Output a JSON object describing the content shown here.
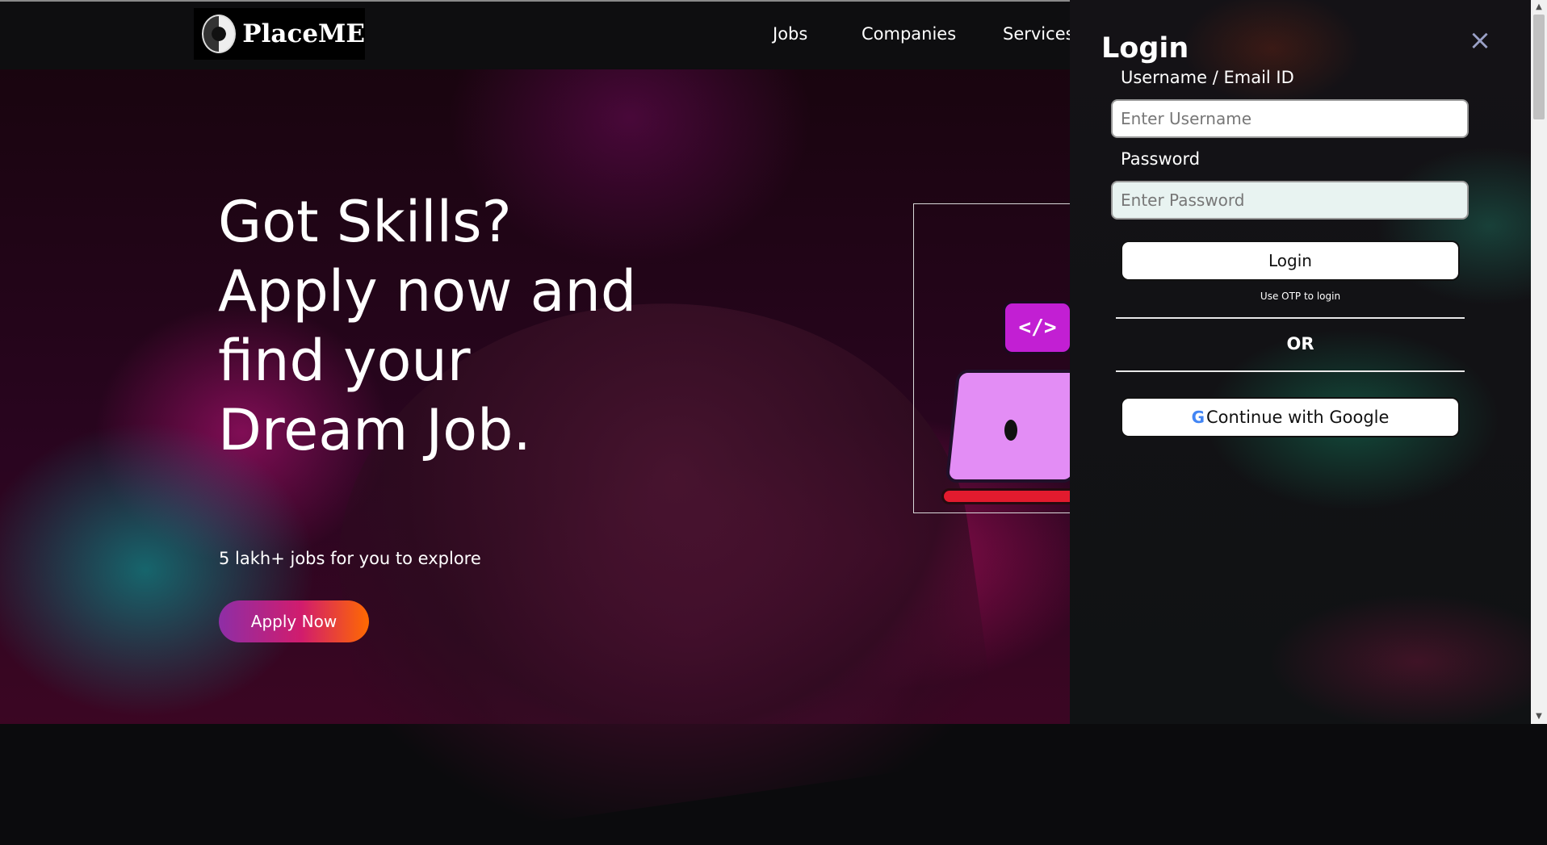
{
  "brand": {
    "name": "PlaceME",
    "logo_icon": "yin-yang-logo-icon"
  },
  "nav": {
    "items": [
      {
        "label": "Jobs"
      },
      {
        "label": "Companies"
      },
      {
        "label": "Services"
      }
    ]
  },
  "hero": {
    "title": "Got Skills? Apply now and find your Dream Job.",
    "subtitle": "5 lakh+ jobs for you to explore",
    "cta_label": "Apply Now",
    "illustration": {
      "code_label": "</>"
    }
  },
  "login": {
    "title": "Login",
    "close_icon": "×",
    "username": {
      "label": "Username / Email ID",
      "placeholder": "Enter Username",
      "value": ""
    },
    "password": {
      "label": "Password",
      "placeholder": "Enter Password",
      "value": ""
    },
    "submit_label": "Login",
    "otp_link": "Use OTP to login",
    "or_text": "OR",
    "google_label": "Continue with Google",
    "google_icon": "G"
  },
  "colors": {
    "cta_gradient": [
      "#8e2ea6",
      "#d11c6d",
      "#ff6a00"
    ],
    "panel_bg": "#141216",
    "accent_close": "#9aa0c6"
  },
  "scrollbar": {
    "up_arrow": "▲",
    "down_arrow": "▼"
  }
}
